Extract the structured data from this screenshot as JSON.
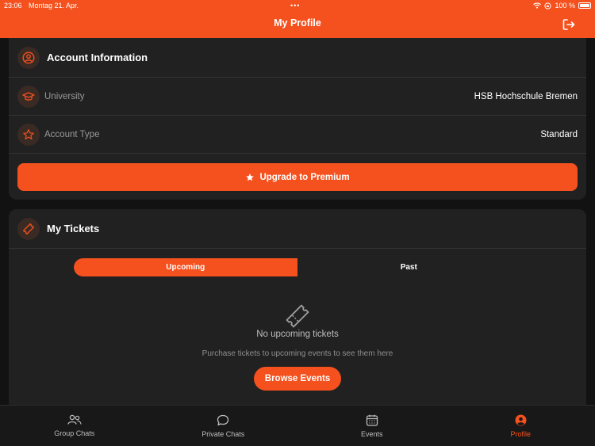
{
  "status_bar": {
    "time": "23:06",
    "date": "Montag 21. Apr.",
    "battery": "100 %"
  },
  "header": {
    "title": "My Profile"
  },
  "account": {
    "title": "Account Information",
    "university_label": "University",
    "university_value": "HSB Hochschule Bremen",
    "type_label": "Account Type",
    "type_value": "Standard",
    "upgrade_label": "Upgrade to Premium"
  },
  "tickets": {
    "title": "My Tickets",
    "tabs": [
      "Upcoming",
      "Past"
    ],
    "empty_title": "No upcoming tickets",
    "empty_subtitle": "Purchase tickets to upcoming events to see them here",
    "browse_label": "Browse Events"
  },
  "tabbar": {
    "items": [
      {
        "label": "Group Chats",
        "icon": "group-icon"
      },
      {
        "label": "Private Chats",
        "icon": "chat-bubble-icon"
      },
      {
        "label": "Events",
        "icon": "calendar-icon"
      },
      {
        "label": "Profile",
        "icon": "profile-icon"
      }
    ],
    "active_index": 3
  },
  "colors": {
    "accent": "#f4511e",
    "card": "#212121",
    "background": "#121212"
  }
}
